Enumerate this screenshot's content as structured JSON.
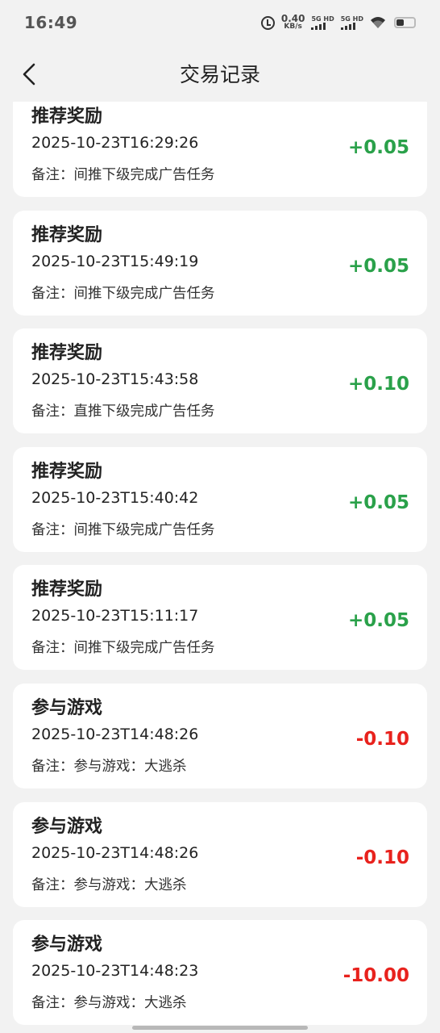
{
  "status_bar": {
    "time": "16:49",
    "net_speed_value": "0.40",
    "net_speed_unit": "KB/s",
    "sim1_label": "5G HD",
    "sim2_label": "5G HD",
    "icons": [
      "alarm-icon",
      "signal-icon",
      "signal-icon",
      "wifi-icon",
      "battery-icon"
    ]
  },
  "header": {
    "title": "交易记录",
    "back_icon": "chevron-left-icon"
  },
  "colors": {
    "positive": "#2aa14a",
    "negative": "#e8221d",
    "background": "#f2f2f2",
    "card": "#ffffff"
  },
  "transactions": [
    {
      "title": "推荐奖励",
      "time": "2025-10-23T16:29:26",
      "note": "备注：间推下级完成广告任务",
      "amount": "+0.05",
      "sign": "positive"
    },
    {
      "title": "推荐奖励",
      "time": "2025-10-23T15:49:19",
      "note": "备注：间推下级完成广告任务",
      "amount": "+0.05",
      "sign": "positive"
    },
    {
      "title": "推荐奖励",
      "time": "2025-10-23T15:43:58",
      "note": "备注：直推下级完成广告任务",
      "amount": "+0.10",
      "sign": "positive"
    },
    {
      "title": "推荐奖励",
      "time": "2025-10-23T15:40:42",
      "note": "备注：间推下级完成广告任务",
      "amount": "+0.05",
      "sign": "positive"
    },
    {
      "title": "推荐奖励",
      "time": "2025-10-23T15:11:17",
      "note": "备注：间推下级完成广告任务",
      "amount": "+0.05",
      "sign": "positive"
    },
    {
      "title": "参与游戏",
      "time": "2025-10-23T14:48:26",
      "note": "备注：参与游戏：大逃杀",
      "amount": "-0.10",
      "sign": "negative"
    },
    {
      "title": "参与游戏",
      "time": "2025-10-23T14:48:26",
      "note": "备注：参与游戏：大逃杀",
      "amount": "-0.10",
      "sign": "negative"
    },
    {
      "title": "参与游戏",
      "time": "2025-10-23T14:48:23",
      "note": "备注：参与游戏：大逃杀",
      "amount": "-10.00",
      "sign": "negative"
    }
  ]
}
